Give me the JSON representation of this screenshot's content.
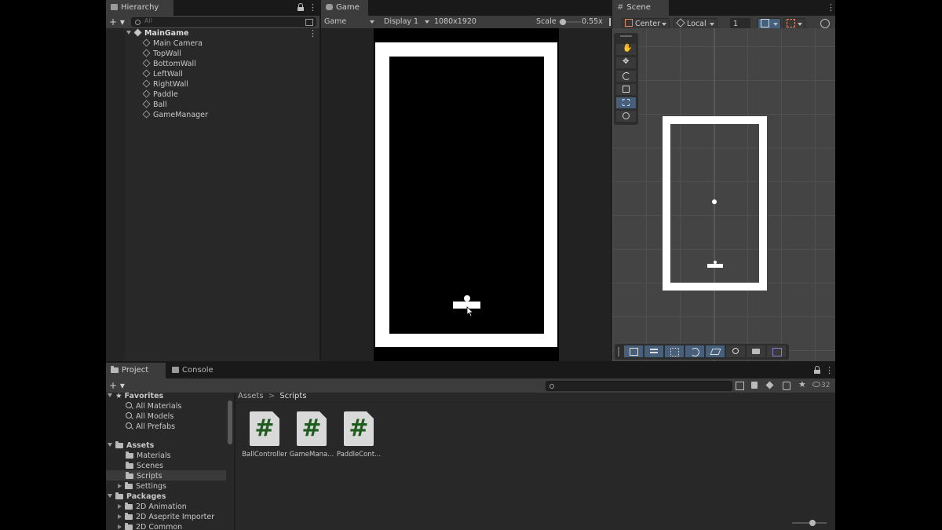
{
  "hierarchy": {
    "tab_label": "Hierarchy",
    "add_label": "+ ▾",
    "search_placeholder": "All",
    "root": "MainGame",
    "items": [
      "Main Camera",
      "TopWall",
      "BottomWall",
      "LeftWall",
      "RightWall",
      "Paddle",
      "Ball",
      "GameManager"
    ]
  },
  "game": {
    "tab_label": "Game",
    "mode_label": "Game",
    "display_label": "Display 1",
    "resolution_label": "1080x1920",
    "scale_label": "Scale",
    "scale_value": "0.55x",
    "scale_fraction": 0.18
  },
  "scene": {
    "tab_label": "Scene",
    "pivot_label": "Center",
    "space_label": "Local",
    "snap_value": "1",
    "tools": [
      "hand-tool",
      "move-tool",
      "rotate-tool",
      "scale-tool",
      "rect-tool",
      "transform-tool"
    ],
    "active_tool": "rect-tool"
  },
  "project": {
    "tab_project": "Project",
    "tab_console": "Console",
    "add_label": "+ ▾",
    "hidden_count": "32",
    "breadcrumb": [
      "Assets",
      "Scripts"
    ],
    "breadcrumb_separator": ">",
    "favorites_label": "Favorites",
    "favorites": [
      "All Materials",
      "All Models",
      "All Prefabs"
    ],
    "assets_label": "Assets",
    "asset_folders": [
      "Materials",
      "Scenes",
      "Scripts",
      "Settings"
    ],
    "selected_folder": "Scripts",
    "packages_label": "Packages",
    "packages": [
      "2D Animation",
      "2D Aseprite Importer",
      "2D Common"
    ],
    "files": [
      {
        "name": "BallController",
        "glyph": "#"
      },
      {
        "name": "GameMana...",
        "glyph": "#"
      },
      {
        "name": "PaddleCont...",
        "glyph": "#"
      }
    ]
  },
  "colors": {
    "panel": "#282828",
    "tab_active": "#3c3c3c",
    "selection": "#3a3a3a",
    "tool_active": "#46607c",
    "script_glyph": "#1f5b1f"
  }
}
